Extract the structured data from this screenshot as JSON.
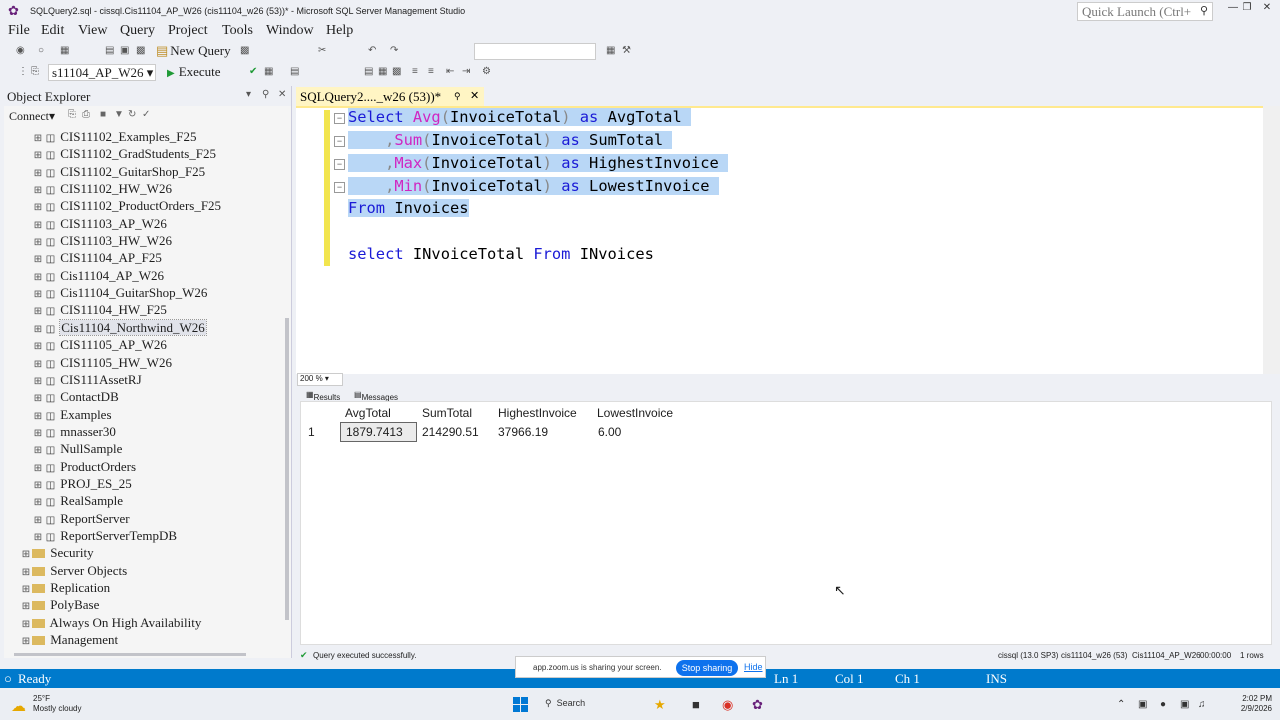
{
  "window": {
    "title": "SQLQuery2.sql - cissql.Cis11104_AP_W26 (cis11104_w26 (53))* - Microsoft SQL Server Management Studio",
    "quick_launch_placeholder": "Quick Launch (Ctrl+"
  },
  "menu": [
    "File",
    "Edit",
    "View",
    "Query",
    "Project",
    "Tools",
    "Window",
    "Help"
  ],
  "toolbar": {
    "new_query_label": "New Query",
    "database": "s11104_AP_W26",
    "execute_label": "Execute"
  },
  "object_explorer": {
    "title": "Object Explorer",
    "connect_label": "Connect",
    "databases": [
      "CIS11102_Examples_F25",
      "CIS11102_GradStudents_F25",
      "CIS11102_GuitarShop_F25",
      "CIS11102_HW_W26",
      "CIS11102_ProductOrders_F25",
      "CIS11103_AP_W26",
      "CIS11103_HW_W26",
      "CIS11104_AP_F25",
      "Cis11104_AP_W26",
      "Cis11104_GuitarShop_W26",
      "CIS11104_HW_F25",
      "Cis11104_Northwind_W26",
      "CIS11105_AP_W26",
      "CIS11105_HW_W26",
      "CIS111AssetRJ",
      "ContactDB",
      "Examples",
      "mnasser30",
      "NullSample",
      "ProductOrders",
      "PROJ_ES_25",
      "RealSample",
      "ReportServer",
      "ReportServerTempDB"
    ],
    "selected_database": "Cis11104_Northwind_W26",
    "folders": [
      "Security",
      "Server Objects",
      "Replication",
      "PolyBase",
      "Always On High Availability",
      "Management"
    ]
  },
  "editor": {
    "tab_label": "SQLQuery2...._w26 (53))*",
    "zoom": "200 %",
    "lines": {
      "l1": {
        "kw": "Select",
        "fn": "Avg",
        "arg": "InvoiceTotal",
        "as": "as",
        "alias": "AvgTotal"
      },
      "l2": {
        "fn": "Sum",
        "arg": "InvoiceTotal",
        "as": "as",
        "alias": "SumTotal"
      },
      "l3": {
        "fn": "Max",
        "arg": "InvoiceTotal",
        "as": "as",
        "alias": "HighestInvoice"
      },
      "l4": {
        "fn": "Min",
        "arg": "InvoiceTotal",
        "as": "as",
        "alias": "LowestInvoice"
      },
      "l5": {
        "kw": "From",
        "table": "Invoices"
      },
      "l7": {
        "kw": "select",
        "col": "INvoiceTotal",
        "from": "From",
        "table": "INvoices"
      }
    }
  },
  "results": {
    "tabs": [
      "Results",
      "Messages"
    ],
    "columns": [
      "AvgTotal",
      "SumTotal",
      "HighestInvoice",
      "LowestInvoice"
    ],
    "row_number": "1",
    "row": [
      "1879.7413",
      "214290.51",
      "37966.19",
      "6.00"
    ]
  },
  "query_status": {
    "message": "Query executed successfully.",
    "server": "cissql (13.0 SP3)",
    "user": "cis11104_w26 (53)",
    "database": "Cis11104_AP_W26",
    "elapsed": "00:00:00",
    "rows": "1 rows"
  },
  "statusbar": {
    "ready": "Ready",
    "ln": "Ln 1",
    "col": "Col 1",
    "ch": "Ch 1",
    "mode": "INS"
  },
  "zoom_share": {
    "message": "app.zoom.us is sharing your screen.",
    "stop_label": "Stop sharing",
    "hide_label": "Hide"
  },
  "taskbar": {
    "temp": "25°F",
    "weather": "Mostly cloudy",
    "search": "Search",
    "time": "2:02 PM",
    "date": "2/9/2026"
  }
}
